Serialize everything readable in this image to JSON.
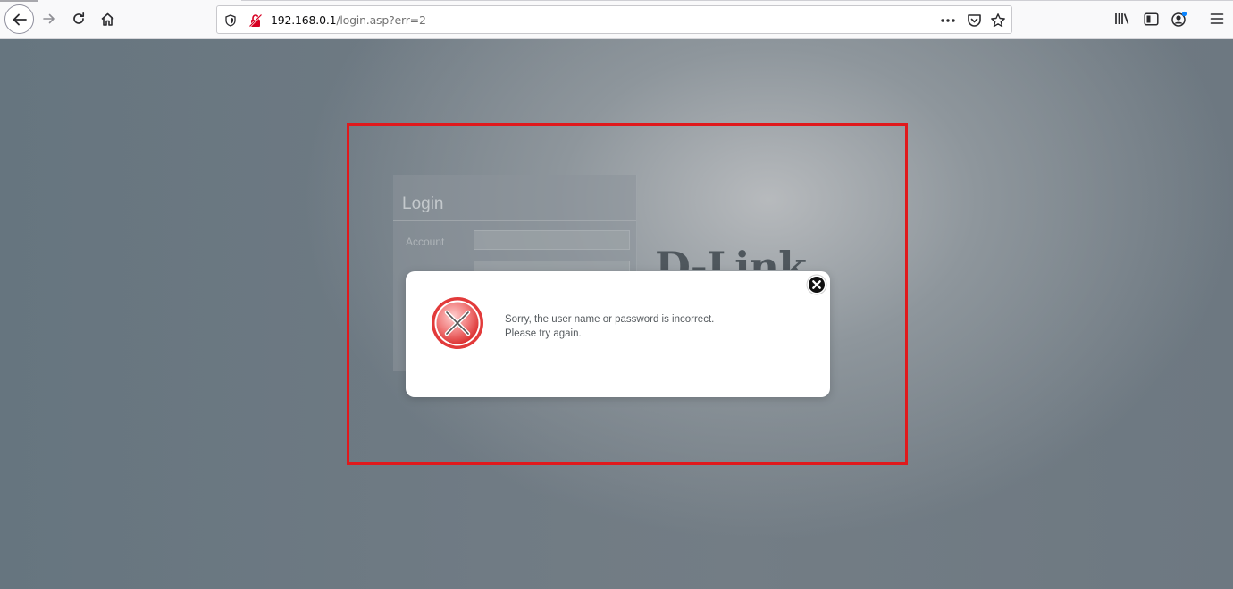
{
  "browser": {
    "url_host": "192.168.0.1",
    "url_path": "/login.asp?err=2",
    "icons": {
      "back": "back-arrow-icon",
      "forward": "forward-arrow-icon",
      "reload": "reload-icon",
      "home": "home-icon",
      "tracking": "tracking-protection-icon",
      "insecure": "insecure-connection-icon",
      "page_actions": "page-actions-icon",
      "pocket": "pocket-icon",
      "bookmark": "bookmark-star-icon",
      "library": "library-icon",
      "sidebar": "sidebar-icon",
      "account": "account-icon",
      "menu": "hamburger-menu-icon"
    }
  },
  "login_panel": {
    "title": "Login",
    "account_label": "Account"
  },
  "brand": {
    "logo_text": "D-Link"
  },
  "dialog": {
    "message_line1": "Sorry, the user name or password is incorrect.",
    "message_line2": "Please try again.",
    "icons": {
      "error": "error-x-icon",
      "close": "close-circle-icon"
    }
  },
  "colors": {
    "highlight_border": "#e0191c",
    "error_red": "#e23a3a",
    "page_bg": "#6f7c86"
  }
}
